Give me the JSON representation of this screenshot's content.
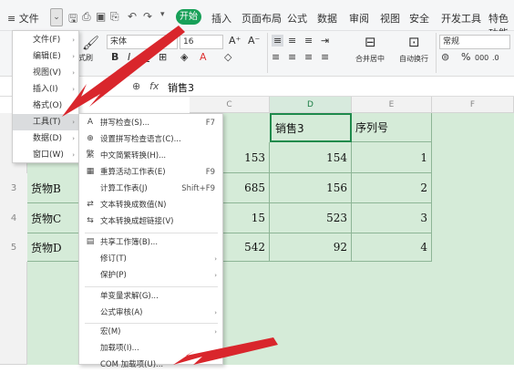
{
  "menubar": {
    "file_label": "文件",
    "qa_icons": [
      "save-icon",
      "print-icon",
      "print-preview-icon",
      "export-pdf-icon",
      "undo-icon",
      "redo-icon",
      "dropdown-icon"
    ],
    "start_tab": "开始",
    "tabs": [
      "插入",
      "页面布局",
      "公式",
      "数据",
      "审阅",
      "视图",
      "安全",
      "开发工具",
      "特色功能"
    ]
  },
  "ribbon": {
    "cut_label": "式刷",
    "font_name": "宋体",
    "font_size": "16",
    "grow_label": "A⁺",
    "shrink_label": "A⁻",
    "bold": "B",
    "italic": "I",
    "merge_label": "合并居中",
    "wrap_label": "自动换行",
    "number_format": "常规",
    "percent": "%",
    "comma": "000"
  },
  "formula_bar": {
    "zoom_symbol": "⊕",
    "fx_label": "fx",
    "value": "销售3"
  },
  "columns": [
    "C",
    "D",
    "E",
    "F"
  ],
  "rows": [
    "3",
    "4",
    "5"
  ],
  "sheet": {
    "header_row": [
      "",
      "销售3",
      "序列号"
    ],
    "data": [
      {
        "name": "",
        "c": "153",
        "d": "154",
        "e": "1"
      },
      {
        "name": "货物B",
        "c": "685",
        "d": "156",
        "e": "2"
      },
      {
        "name": "货物C",
        "c": "15",
        "d": "523",
        "e": "3"
      },
      {
        "name": "货物D",
        "c": "542",
        "d": "92",
        "e": "4"
      }
    ]
  },
  "file_menu": [
    {
      "label": "文件(F)"
    },
    {
      "label": "编辑(E)"
    },
    {
      "label": "视图(V)"
    },
    {
      "label": "插入(I)"
    },
    {
      "label": "格式(O)"
    },
    {
      "label": "工具(T)"
    },
    {
      "label": "数据(D)"
    },
    {
      "label": "窗口(W)"
    }
  ],
  "tools_menu": [
    {
      "label": "拼写检查(S)...",
      "shortcut": "F7",
      "icon": "spellcheck-icon"
    },
    {
      "label": "设置拼写检查语言(C)...",
      "shortcut": "",
      "icon": "language-icon"
    },
    {
      "label": "中文简繁转换(H)...",
      "shortcut": "",
      "icon": "translate-icon"
    },
    {
      "label": "重算活动工作表(E)",
      "shortcut": "F9",
      "icon": "recalc-icon"
    },
    {
      "label": "计算工作表(J)",
      "shortcut": "Shift+F9",
      "icon": ""
    },
    {
      "label": "文本转换成数值(N)",
      "shortcut": "",
      "icon": "convert-number-icon"
    },
    {
      "label": "文本转换成超链接(V)",
      "shortcut": "",
      "icon": "convert-link-icon"
    },
    {
      "label": "共享工作簿(B)...",
      "shortcut": "",
      "icon": "share-icon"
    },
    {
      "label": "修订(T)",
      "shortcut": "",
      "icon": ""
    },
    {
      "label": "保护(P)",
      "shortcut": "",
      "icon": ""
    },
    {
      "label": "单变量求解(G)...",
      "shortcut": "",
      "icon": ""
    },
    {
      "label": "公式审核(A)",
      "shortcut": "",
      "icon": ""
    },
    {
      "label": "宏(M)",
      "shortcut": "",
      "icon": ""
    },
    {
      "label": "加载项(I)...",
      "shortcut": "",
      "icon": ""
    },
    {
      "label": "COM 加载项(U)...",
      "shortcut": "",
      "icon": ""
    }
  ],
  "colors": {
    "accent": "#18a058",
    "arrow": "#d9262c",
    "sheet_bg": "#d5ebd8"
  }
}
